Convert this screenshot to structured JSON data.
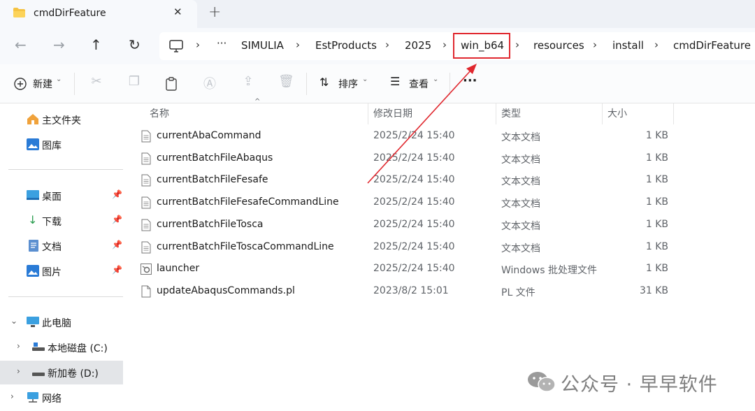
{
  "tab": {
    "title": "cmdDirFeature",
    "close_glyph": "✕",
    "new_glyph": "+"
  },
  "nav": {
    "back": "←",
    "forward": "→",
    "up": "↑",
    "refresh": "↻"
  },
  "breadcrumb": {
    "more": "···",
    "separator": "›",
    "items": [
      "SIMULIA",
      "EstProducts",
      "2025",
      "win_b64",
      "resources",
      "install",
      "cmdDirFeature"
    ],
    "highlighted": "win_b64"
  },
  "toolbar": {
    "new_label": "新建",
    "sort_label": "排序",
    "view_label": "查看",
    "more_glyph": "···"
  },
  "sidebar": {
    "home": "主文件夹",
    "gallery": "图库",
    "pinned": [
      "桌面",
      "下载",
      "文档",
      "图片"
    ],
    "pc": "此电脑",
    "drives": [
      "本地磁盘 (C:)",
      "新加卷 (D:)"
    ],
    "network": "网络",
    "pin_glyph": "📌"
  },
  "columns": {
    "name": "名称",
    "date": "修改日期",
    "type": "类型",
    "size": "大小"
  },
  "files": [
    {
      "name": "currentAbaCommand",
      "date": "2025/2/24 15:40",
      "type": "文本文档",
      "size": "1 KB",
      "icon": "text-file-icon"
    },
    {
      "name": "currentBatchFileAbaqus",
      "date": "2025/2/24 15:40",
      "type": "文本文档",
      "size": "1 KB",
      "icon": "text-file-icon"
    },
    {
      "name": "currentBatchFileFesafe",
      "date": "2025/2/24 15:40",
      "type": "文本文档",
      "size": "1 KB",
      "icon": "text-file-icon"
    },
    {
      "name": "currentBatchFileFesafeCommandLine",
      "date": "2025/2/24 15:40",
      "type": "文本文档",
      "size": "1 KB",
      "icon": "text-file-icon"
    },
    {
      "name": "currentBatchFileTosca",
      "date": "2025/2/24 15:40",
      "type": "文本文档",
      "size": "1 KB",
      "icon": "text-file-icon"
    },
    {
      "name": "currentBatchFileToscaCommandLine",
      "date": "2025/2/24 15:40",
      "type": "文本文档",
      "size": "1 KB",
      "icon": "text-file-icon"
    },
    {
      "name": "launcher",
      "date": "2025/2/24 15:40",
      "type": "Windows 批处理文件",
      "size": "1 KB",
      "icon": "batch-file-icon"
    },
    {
      "name": "updateAbaqusCommands.pl",
      "date": "2023/8/2 15:01",
      "type": "PL 文件",
      "size": "31 KB",
      "icon": "blank-file-icon"
    }
  ],
  "watermark": {
    "text": "公众号 · 早早软件"
  },
  "colors": {
    "highlight": "#e0282f",
    "selected_row": "#e3e5e8",
    "accent": "#0067c0"
  }
}
